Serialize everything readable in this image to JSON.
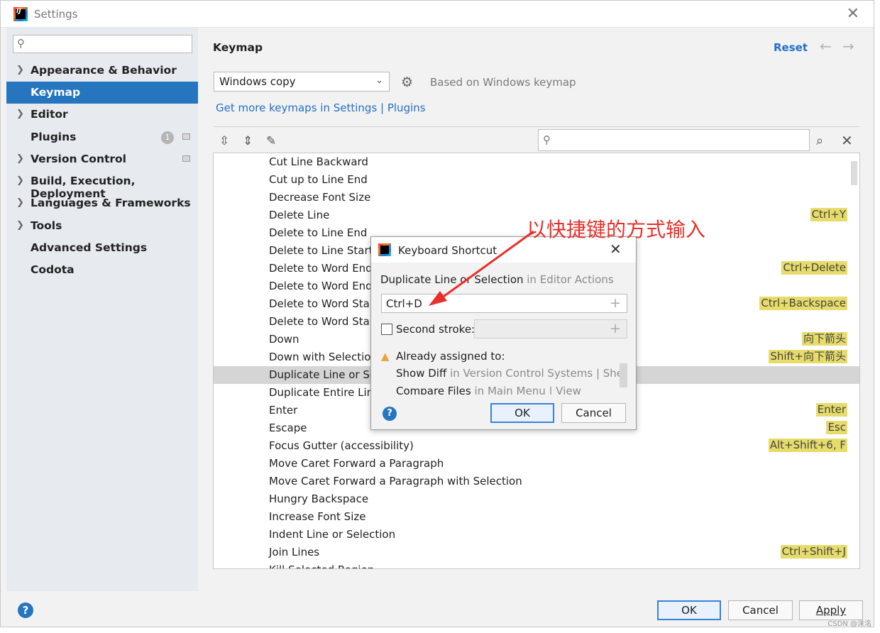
{
  "window": {
    "title": "Settings"
  },
  "sidebar": {
    "items": [
      {
        "label": "Appearance & Behavior",
        "expandable": true
      },
      {
        "label": "Keymap",
        "expandable": false,
        "selected": true
      },
      {
        "label": "Editor",
        "expandable": true
      },
      {
        "label": "Plugins",
        "expandable": false,
        "badge": "1"
      },
      {
        "label": "Version Control",
        "expandable": true
      },
      {
        "label": "Build, Execution, Deployment",
        "expandable": true
      },
      {
        "label": "Languages & Frameworks",
        "expandable": true
      },
      {
        "label": "Tools",
        "expandable": true
      },
      {
        "label": "Advanced Settings",
        "expandable": false
      },
      {
        "label": "Codota",
        "expandable": false
      }
    ]
  },
  "header": {
    "title": "Keymap",
    "reset": "Reset"
  },
  "keymap": {
    "selected": "Windows copy",
    "based_on": "Based on Windows keymap",
    "more_link": "Get more keymaps in Settings | Plugins"
  },
  "actions": [
    {
      "name": "Cut Line Backward",
      "shortcut": ""
    },
    {
      "name": "Cut up to Line End",
      "shortcut": ""
    },
    {
      "name": "Decrease Font Size",
      "shortcut": ""
    },
    {
      "name": "Delete Line",
      "shortcut": "Ctrl+Y"
    },
    {
      "name": "Delete to Line End",
      "shortcut": ""
    },
    {
      "name": "Delete to Line Start",
      "shortcut": ""
    },
    {
      "name": "Delete to Word End",
      "shortcut": "Ctrl+Delete"
    },
    {
      "name": "Delete to Word End",
      "shortcut": ""
    },
    {
      "name": "Delete to Word Star",
      "shortcut": "Ctrl+Backspace"
    },
    {
      "name": "Delete to Word Star",
      "shortcut": ""
    },
    {
      "name": "Down",
      "shortcut": "向下箭头"
    },
    {
      "name": "Down with Selection",
      "shortcut": "Shift+向下箭头"
    },
    {
      "name": "Duplicate Line or Se",
      "shortcut": "",
      "selected": true
    },
    {
      "name": "Duplicate Entire Line",
      "shortcut": ""
    },
    {
      "name": "Enter",
      "shortcut": "Enter"
    },
    {
      "name": "Escape",
      "shortcut": "Esc"
    },
    {
      "name": "Focus Gutter (accessibility)",
      "shortcut": "Alt+Shift+6, F"
    },
    {
      "name": "Move Caret Forward a Paragraph",
      "shortcut": ""
    },
    {
      "name": "Move Caret Forward a Paragraph with Selection",
      "shortcut": ""
    },
    {
      "name": "Hungry Backspace",
      "shortcut": ""
    },
    {
      "name": "Increase Font Size",
      "shortcut": ""
    },
    {
      "name": "Indent Line or Selection",
      "shortcut": ""
    },
    {
      "name": "Join Lines",
      "shortcut": "Ctrl+Shift+J"
    },
    {
      "name": "Kill Selected Region",
      "shortcut": ""
    }
  ],
  "dialog": {
    "title": "Keyboard Shortcut",
    "action_name": "Duplicate Line or Selection",
    "action_group": " in Editor Actions",
    "shortcut_value": "Ctrl+D",
    "second_stroke_label": "Second stroke:",
    "already_assigned": "Already assigned to:",
    "conflicts": [
      {
        "name": "Show Diff",
        "where": " in Version Control Systems | Shel"
      },
      {
        "name": "Compare Files",
        "where": " in Main Menu | View"
      }
    ],
    "ok": "OK",
    "cancel": "Cancel"
  },
  "annotation": "以快捷键的方式输入",
  "footer": {
    "ok": "OK",
    "cancel": "Cancel",
    "apply": "Apply"
  },
  "watermark": "CSDN @沫洺",
  "colors": {
    "accent": "#2675bf",
    "highlight": "#e7dc6a",
    "annotation": "#e8302a",
    "link": "#2470c6"
  }
}
